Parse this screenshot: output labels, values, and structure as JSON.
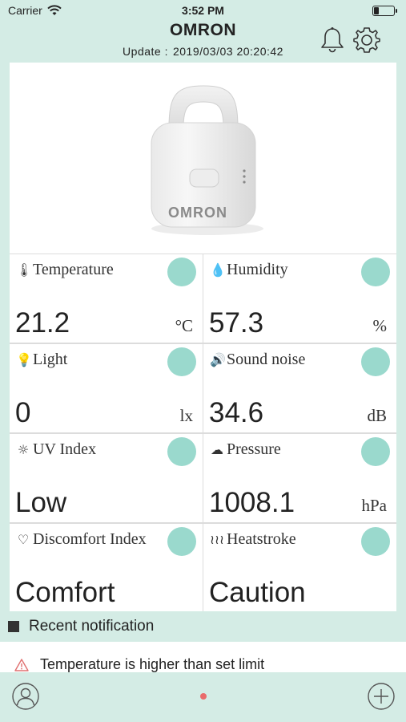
{
  "status_bar": {
    "carrier": "Carrier",
    "time": "3:52 PM",
    "battery_level": 0.25
  },
  "header": {
    "title": "OMRON",
    "update_label": "Update :",
    "update_value": "2019/03/03 20:20:42"
  },
  "device": {
    "brand_text": "OMRON"
  },
  "sensors": [
    {
      "label": "Temperature",
      "icon": "thermometer-icon",
      "value": "21.2",
      "unit": "°C"
    },
    {
      "label": "Humidity",
      "icon": "droplet-icon",
      "value": "57.3",
      "unit": "%"
    },
    {
      "label": "Light",
      "icon": "lightbulb-icon",
      "value": "0",
      "unit": "lx"
    },
    {
      "label": "Sound noise",
      "icon": "speaker-icon",
      "value": "34.6",
      "unit": "dB"
    },
    {
      "label": "UV Index",
      "icon": "sun-icon",
      "value": "Low",
      "unit": ""
    },
    {
      "label": "Pressure",
      "icon": "cloud-upload-icon",
      "value": "1008.1",
      "unit": "hPa"
    },
    {
      "label": "Discomfort Index",
      "icon": "heart-icon",
      "value": "Comfort",
      "unit": ""
    },
    {
      "label": "Heatstroke",
      "icon": "heat-waves-icon",
      "value": "Caution",
      "unit": ""
    }
  ],
  "notifications": {
    "title": "Recent notification",
    "items": [
      {
        "text": "Temperature is higher than set limit",
        "icon": "warning-icon"
      }
    ]
  },
  "colors": {
    "accent": "#d4ece5",
    "smiley": "#9ad9cd",
    "page_dot": "#e96b6b"
  }
}
